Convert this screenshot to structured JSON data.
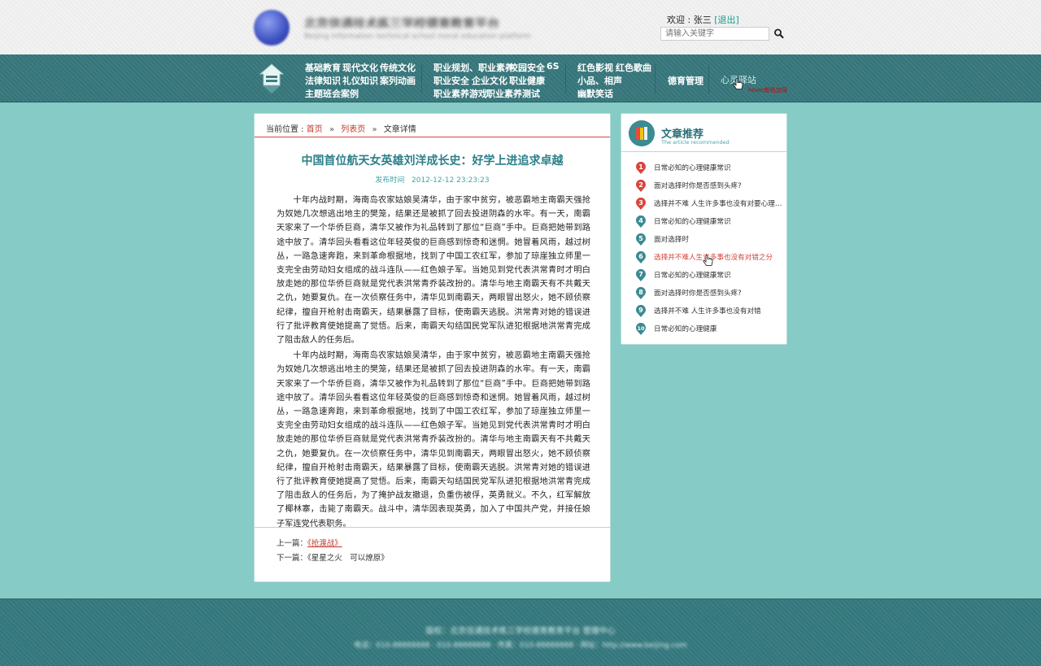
{
  "header": {
    "site_title": "北京信通技术练三学校德育教育平台",
    "site_subtitle": "Beijing Information technical school moral education platform",
    "welcome_prefix": "欢迎 :",
    "user_name": "张三",
    "logout_label": "[退出]",
    "search_placeholder": "请输入关键字"
  },
  "nav": {
    "group1": [
      "基础教育",
      "现代文化",
      "传统文化",
      "法律知识",
      "礼仪知识",
      "案列动画",
      "主题班会案例"
    ],
    "group2": [
      "职业规划、职业素养",
      "校园安全",
      "6S",
      "职业安全",
      "企业文化",
      "职业健康",
      "职业素养游戏",
      "职业素养测试"
    ],
    "group3": [
      "红色影视",
      "红色歌曲",
      "小品、相声",
      "幽默笑话"
    ],
    "moral": "德育管理",
    "mind": "心灵驿站",
    "hover_note": "hover颜色加深"
  },
  "breadcrumb": {
    "prefix": "当前位置 :",
    "home": "首页",
    "list": "列表页",
    "current": "文章详情",
    "separator": "»"
  },
  "article": {
    "title": "中国首位航天女英雄刘洋成长史：好学上进追求卓越",
    "pubtime_label": "发布时间",
    "pubtime": "2012-12-12  23:23:23",
    "paragraphs": [
      "十年内战时期，海南岛农家姑娘吴清华，由于家中贫穷，被恶霸地主南霸天强抢为奴她几次想逃出地主的樊笼，结果还是被抓了回去投进阴森的水牢。有一天，南霸天家来了一个华侨巨商，清华又被作为礼品转到了那位“巨商”手中。巨商把她带到路途中放了。清华回头看看这位年轻英俊的巨商感到惊奇和迷惘。她冒着风雨，越过树丛，一路急速奔跑，来到革命根据地，找到了中国工农红军，参加了琼崖独立师里一支完全由劳动妇女组成的战斗连队——红色娘子军。当她见到党代表洪常青时才明白放走她的那位华侨巨商就是党代表洪常青乔装改扮的。清华与地主南霸天有不共戴天之仇，她要复仇。在一次侦察任务中，清华见到南霸天，两眼冒出怒火，她不顾侦察纪律，擅自开枪射击南霸天，结果暴露了目标，使南霸天逃脱。洪常青对她的错误进行了批评教育使她提高了觉悟。后来，南霸天勾结国民党军队进犯根据地洪常青完成了阻击敌人的任务后。",
      "十年内战时期，海南岛农家姑娘吴清华，由于家中贫穷，被恶霸地主南霸天强抢为奴她几次想逃出地主的樊笼，结果还是被抓了回去投进阴森的水牢。有一天，南霸天家来了一个华侨巨商，清华又被作为礼品转到了那位“巨商”手中。巨商把她带到路途中放了。清华回头看看这位年轻英俊的巨商感到惊奇和迷惘。她冒着风雨，越过树丛，一路急速奔跑，来到革命根据地，找到了中国工农红军，参加了琼崖独立师里一支完全由劳动妇女组成的战斗连队——红色娘子军。当她见到党代表洪常青时才明白放走她的那位华侨巨商就是党代表洪常青乔装改扮的。清华与地主南霸天有不共戴天之仇，她要复仇。在一次侦察任务中，清华见到南霸天，两眼冒出怒火，她不顾侦察纪律，擅自开枪射击南霸天，结果暴露了目标，使南霸天逃脱。洪常青对她的错误进行了批评教育使她提高了觉悟。后来，南霸天勾结国民党军队进犯根据地洪常青完成了阻击敌人的任务后，为了掩护战友撤退，负重伤被俘，英勇就义。不久，红军解放了椰林寨，击毙了南霸天。战斗中，清华因表现英勇，加入了中国共产党，并接任娘子军连党代表职务。"
    ],
    "prev_label": "上一篇：",
    "prev_title": "《抢渡战》",
    "next_label": "下一篇：",
    "next_title": "《星星之火　可以燎原》"
  },
  "sidebar": {
    "title": "文章推荐",
    "subtitle": "The article recommended",
    "items": [
      {
        "num": "1",
        "text": "日常必知的心理健康常识"
      },
      {
        "num": "2",
        "text": "面对选择时你是否感到头疼?"
      },
      {
        "num": "3",
        "text": "选择并不难 人生许多事也没有对要心理之分"
      },
      {
        "num": "4",
        "text": "日常必知的心理健康常识"
      },
      {
        "num": "5",
        "text": "面对选择时"
      },
      {
        "num": "6",
        "text": "选择并不难人生许多事也没有对错之分"
      },
      {
        "num": "7",
        "text": "日常必知的心理健康常识"
      },
      {
        "num": "8",
        "text": "面对选择时你是否感到头疼?"
      },
      {
        "num": "9",
        "text": "选择并不难 人生许多事也没有对错"
      },
      {
        "num": "10",
        "text": "日常必知的心理健康"
      }
    ]
  },
  "footer": {
    "line1": "版权：北京信通技术练三学校德育教育平台 管理中心",
    "line2": "电话：010-88888888 · 010-88888888 · 传真：010-88888888 · 网址：http://www.beijing.com"
  },
  "colors": {
    "accent": "#2b7f8a",
    "link_red": "#d2463b",
    "background": "#86cbc5",
    "nav_bg": "#3d7e83",
    "badge_red": "#d8463d",
    "badge_teal": "#3c8a92"
  }
}
